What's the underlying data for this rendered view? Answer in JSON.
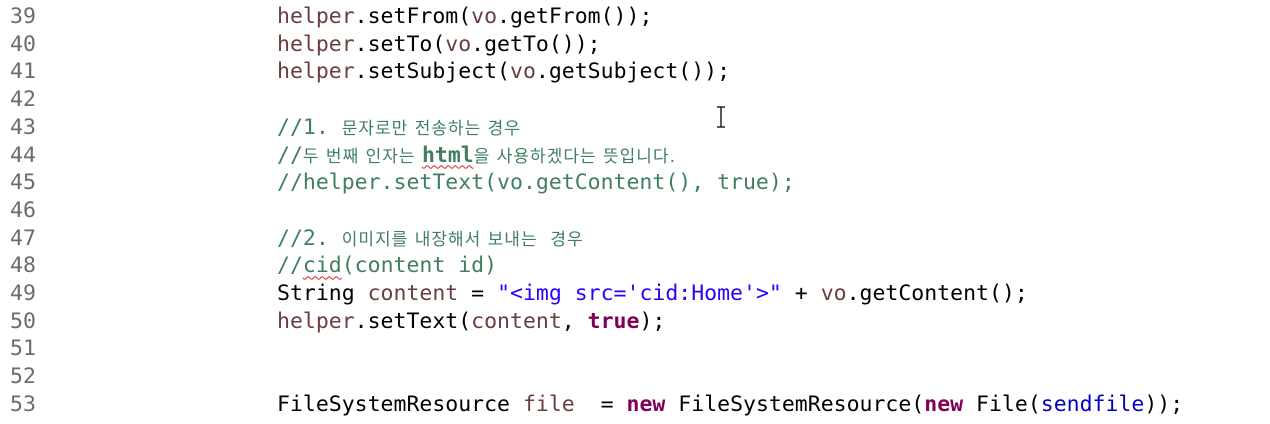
{
  "editor": {
    "lines": [
      {
        "num": "39",
        "segments": [
          {
            "text": "helper",
            "cls": "var"
          },
          {
            "text": ".setFrom(",
            "cls": ""
          },
          {
            "text": "vo",
            "cls": "var"
          },
          {
            "text": ".getFrom());",
            "cls": ""
          }
        ]
      },
      {
        "num": "40",
        "segments": [
          {
            "text": "helper",
            "cls": "var"
          },
          {
            "text": ".setTo(",
            "cls": ""
          },
          {
            "text": "vo",
            "cls": "var"
          },
          {
            "text": ".getTo());",
            "cls": ""
          }
        ]
      },
      {
        "num": "41",
        "segments": [
          {
            "text": "helper",
            "cls": "var"
          },
          {
            "text": ".setSubject(",
            "cls": ""
          },
          {
            "text": "vo",
            "cls": "var"
          },
          {
            "text": ".getSubject());",
            "cls": ""
          }
        ]
      },
      {
        "num": "42",
        "segments": []
      },
      {
        "num": "43",
        "segments": [
          {
            "text": "//1. ",
            "cls": "cm"
          },
          {
            "text": "문자로만 전송하는 경우",
            "cls": "cm kr"
          }
        ]
      },
      {
        "num": "44",
        "segments": [
          {
            "text": "//",
            "cls": "cm"
          },
          {
            "text": "두 번째 인자는 ",
            "cls": "cm kr"
          },
          {
            "text": "html",
            "cls": "cm bold-cm squiggle"
          },
          {
            "text": "을 사용하겠다는 뜻입니다.",
            "cls": "cm kr"
          }
        ]
      },
      {
        "num": "45",
        "segments": [
          {
            "text": "//helper.setText(vo.getContent(), true);",
            "cls": "cm"
          }
        ]
      },
      {
        "num": "46",
        "segments": []
      },
      {
        "num": "47",
        "segments": [
          {
            "text": "//2. ",
            "cls": "cm"
          },
          {
            "text": "이미지를 내장해서 보내는  경우",
            "cls": "cm kr"
          }
        ]
      },
      {
        "num": "48",
        "segments": [
          {
            "text": "//",
            "cls": "cm"
          },
          {
            "text": "cid",
            "cls": "cm squiggle"
          },
          {
            "text": "(content id)",
            "cls": "cm"
          }
        ]
      },
      {
        "num": "49",
        "segments": [
          {
            "text": "String ",
            "cls": ""
          },
          {
            "text": "content",
            "cls": "var"
          },
          {
            "text": " = ",
            "cls": ""
          },
          {
            "text": "\"<img src='cid:Home'>\"",
            "cls": "str"
          },
          {
            "text": " + ",
            "cls": ""
          },
          {
            "text": "vo",
            "cls": "var"
          },
          {
            "text": ".getContent();",
            "cls": ""
          }
        ]
      },
      {
        "num": "50",
        "segments": [
          {
            "text": "helper",
            "cls": "var"
          },
          {
            "text": ".setText(",
            "cls": ""
          },
          {
            "text": "content",
            "cls": "var"
          },
          {
            "text": ", ",
            "cls": ""
          },
          {
            "text": "true",
            "cls": "kw"
          },
          {
            "text": ");",
            "cls": ""
          }
        ]
      },
      {
        "num": "51",
        "segments": []
      },
      {
        "num": "52",
        "segments": []
      },
      {
        "num": "53",
        "segments": [
          {
            "text": "FileSystemResource ",
            "cls": ""
          },
          {
            "text": "file",
            "cls": "var"
          },
          {
            "text": "  = ",
            "cls": ""
          },
          {
            "text": "new",
            "cls": "kw"
          },
          {
            "text": " FileSystemResource(",
            "cls": ""
          },
          {
            "text": "new",
            "cls": "kw"
          },
          {
            "text": " File(",
            "cls": ""
          },
          {
            "text": "sendfile",
            "cls": "field"
          },
          {
            "text": "));",
            "cls": ""
          }
        ]
      }
    ]
  },
  "colors": {
    "keyword": "#7f0055",
    "local_variable": "#6a3e3e",
    "string": "#2a00ff",
    "field": "#0000c0",
    "comment": "#3f7f5f",
    "line_number": "#6b6b6b"
  },
  "cursor": {
    "icon": "text-cursor-icon"
  }
}
